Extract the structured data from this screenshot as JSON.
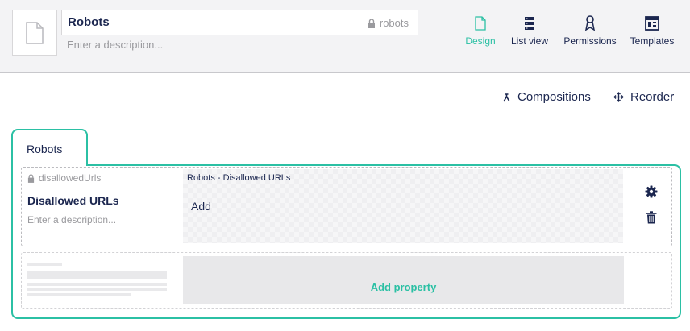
{
  "header": {
    "name": "Robots",
    "alias": "robots",
    "description_placeholder": "Enter a description..."
  },
  "nav": [
    {
      "label": "Design",
      "icon": "document-icon",
      "active": true
    },
    {
      "label": "List view",
      "icon": "list-view-icon",
      "active": false
    },
    {
      "label": "Permissions",
      "icon": "permissions-icon",
      "active": false
    },
    {
      "label": "Templates",
      "icon": "templates-icon",
      "active": false
    }
  ],
  "toolbar": {
    "compositions_label": "Compositions",
    "reorder_label": "Reorder"
  },
  "tab": {
    "label": "Robots"
  },
  "property": {
    "alias": "disallowedUrls",
    "name": "Disallowed URLs",
    "description_placeholder": "Enter a description...",
    "editor_title": "Robots - Disallowed URLs",
    "editor_action": "Add"
  },
  "add_property_label": "Add property",
  "colors": {
    "accent": "#2bc0a4",
    "text": "#1b264f",
    "muted": "#9a9a9e",
    "header_bg": "#f3f3f5"
  }
}
